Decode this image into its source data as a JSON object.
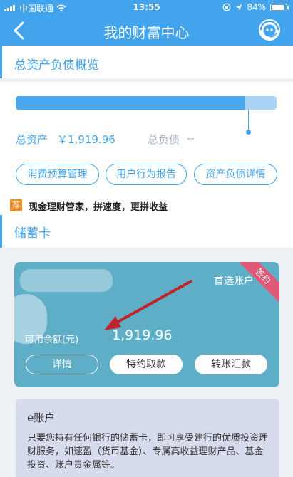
{
  "status_bar": {
    "carrier": "中国联通",
    "time": "13:55",
    "battery": "84%",
    "battery_level": 0.84
  },
  "header": {
    "title": "我的财富中心"
  },
  "overview": {
    "section_title": "总资产负债概览",
    "asset_ratio": 0.88,
    "total_assets_label": "总资产",
    "total_assets_value": "￥1,919.96",
    "total_liabilities_label": "总负债",
    "total_liabilities_value": "--",
    "buttons": [
      "消费预算管理",
      "用户行为报告",
      "资产负债详情"
    ]
  },
  "promo": {
    "badge": "荐",
    "text": "现金理财管家，拼速度，更拼收益"
  },
  "savings": {
    "section_title": "储蓄卡",
    "card": {
      "preferred_label": "首选账户",
      "ribbon": "签约",
      "available_label": "可用余额(元)",
      "available_value": "1,919.96",
      "buttons": {
        "details": "详情",
        "withdraw": "特约取款",
        "transfer": "转账汇款"
      }
    }
  },
  "e_account": {
    "title": "e账户",
    "description": "只要您持有任何银行的储蓄卡，即可享受建行的优质投资理财服务，如速盈（货币基金）、专属高收益理财产品、基金投资、账户贵金属等。"
  },
  "colors": {
    "primary": "#43a4ee",
    "card": "#5eaec8",
    "ribbon": "#e05a78",
    "arrow": "#c0242a",
    "badge": "#ef8d2a"
  }
}
